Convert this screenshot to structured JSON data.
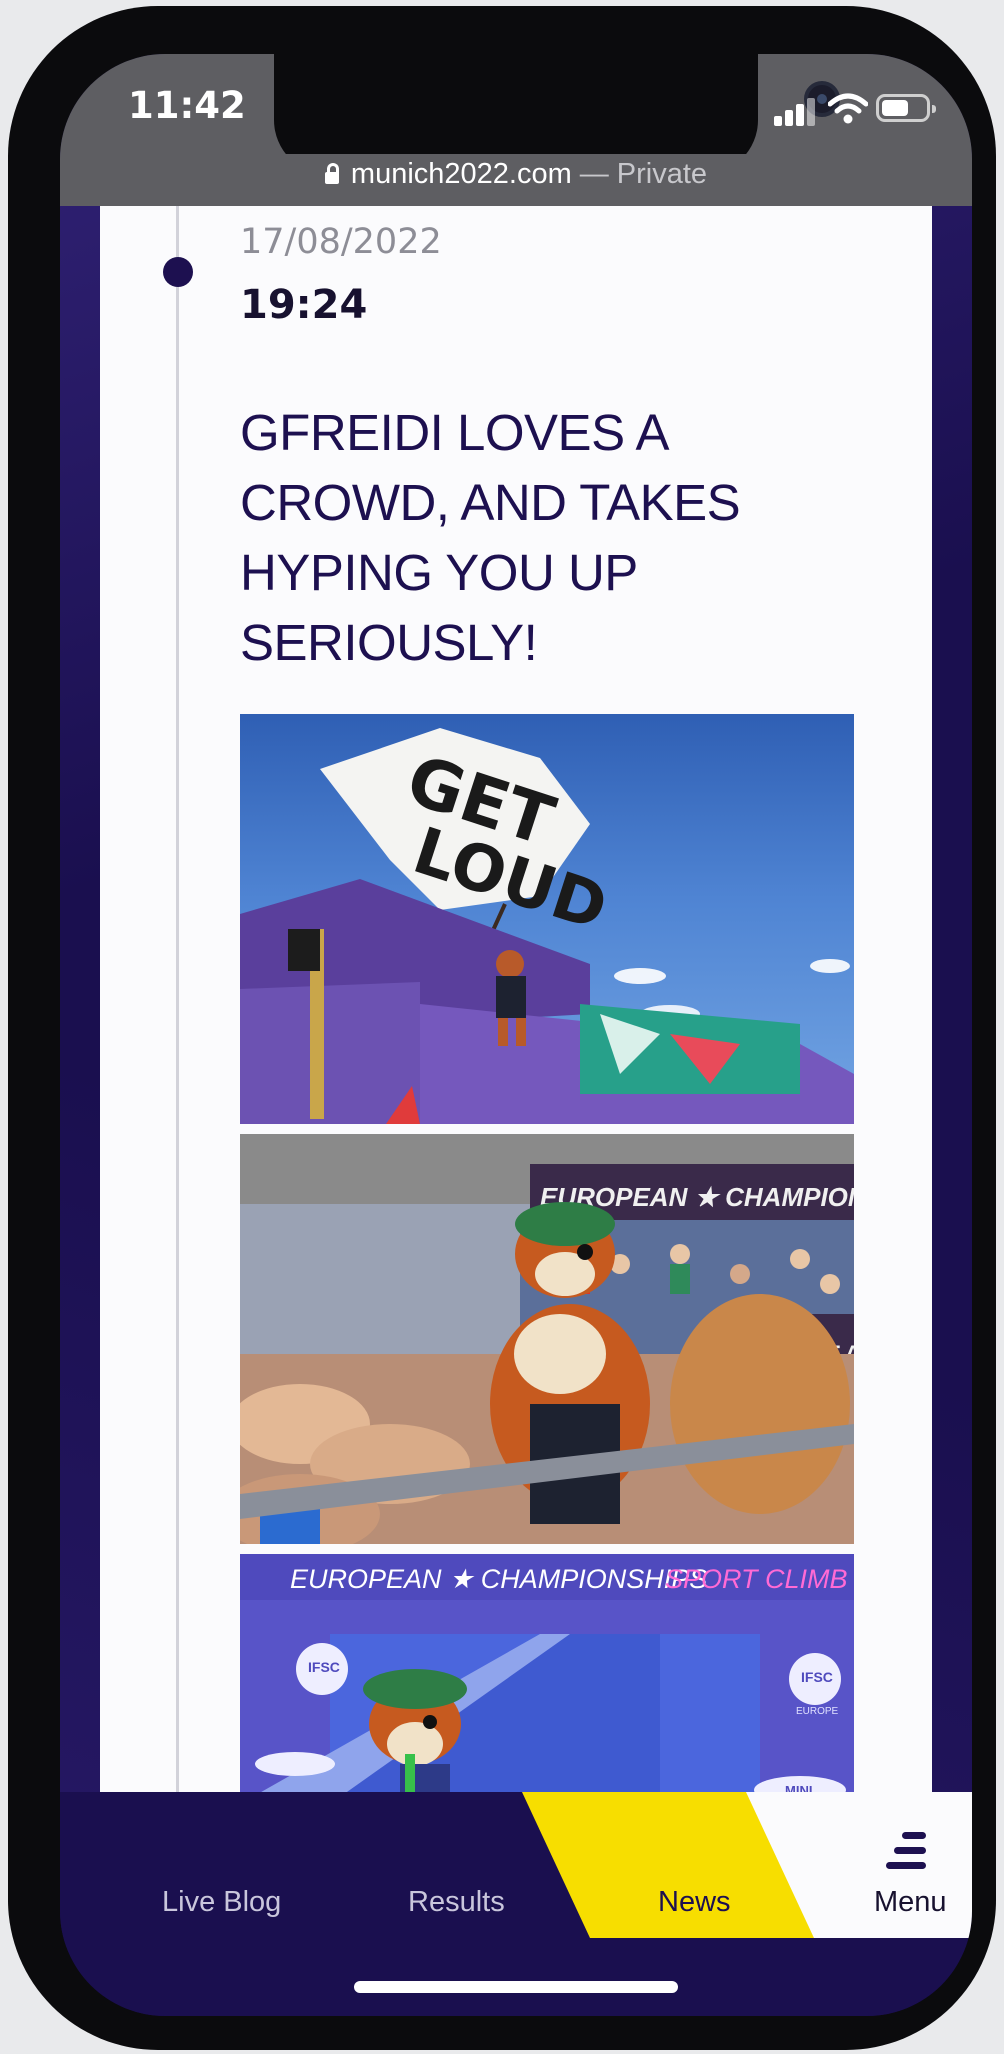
{
  "status_bar": {
    "time": "11:42"
  },
  "browser": {
    "domain": "munich2022.com",
    "mode": "— Private"
  },
  "entry": {
    "date": "17/08/2022",
    "time": "19:24",
    "headline": "GFREIDI LOVES A CROWD, AND TAKES HYPING YOU UP SERIOUSLY!",
    "photo1": {
      "flag_text_line1": "GET",
      "flag_text_line2": "LOUD"
    },
    "photo2": {
      "banner_text": "EUROPEAN ★ CHAMPIONSHIPS BEA",
      "side_banner": "OPEAN"
    },
    "photo3": {
      "banner_left": "EUROPEAN ★ CHAMPIONSHIPS",
      "banner_right": "SPORT CLIMB",
      "logo_text": "IFSC",
      "logo_sub": "EUROPE",
      "car_logo": "MINI"
    }
  },
  "bottom_nav": {
    "live_blog": "Live Blog",
    "results": "Results",
    "news": "News",
    "menu": "Menu"
  },
  "colors": {
    "brand_navy": "#1a0f4f",
    "accent_yellow": "#f7de00",
    "text_dark": "#1d1050"
  }
}
